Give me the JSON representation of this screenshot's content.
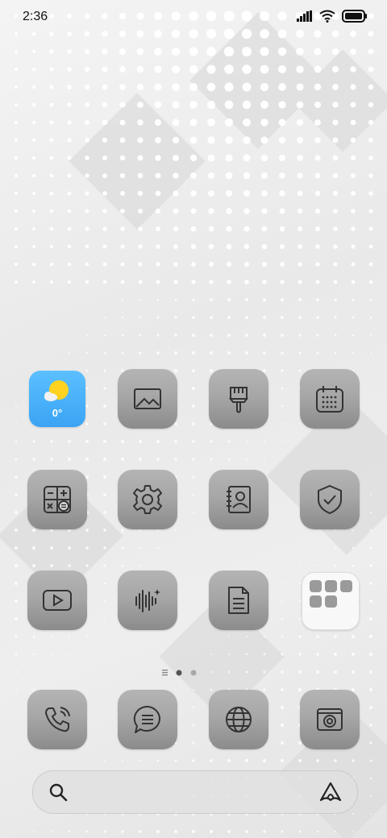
{
  "status_bar": {
    "time": "2:36"
  },
  "apps": [
    {
      "name": "weather",
      "temp": "0°"
    },
    {
      "name": "gallery"
    },
    {
      "name": "themes"
    },
    {
      "name": "calendar"
    },
    {
      "name": "calculator"
    },
    {
      "name": "settings"
    },
    {
      "name": "contacts"
    },
    {
      "name": "security"
    },
    {
      "name": "video"
    },
    {
      "name": "recorder"
    },
    {
      "name": "notes"
    },
    {
      "name": "folder"
    }
  ],
  "dock": [
    {
      "name": "phone"
    },
    {
      "name": "messages"
    },
    {
      "name": "browser"
    },
    {
      "name": "camera"
    }
  ],
  "pager": {
    "current": 1,
    "total": 2
  }
}
